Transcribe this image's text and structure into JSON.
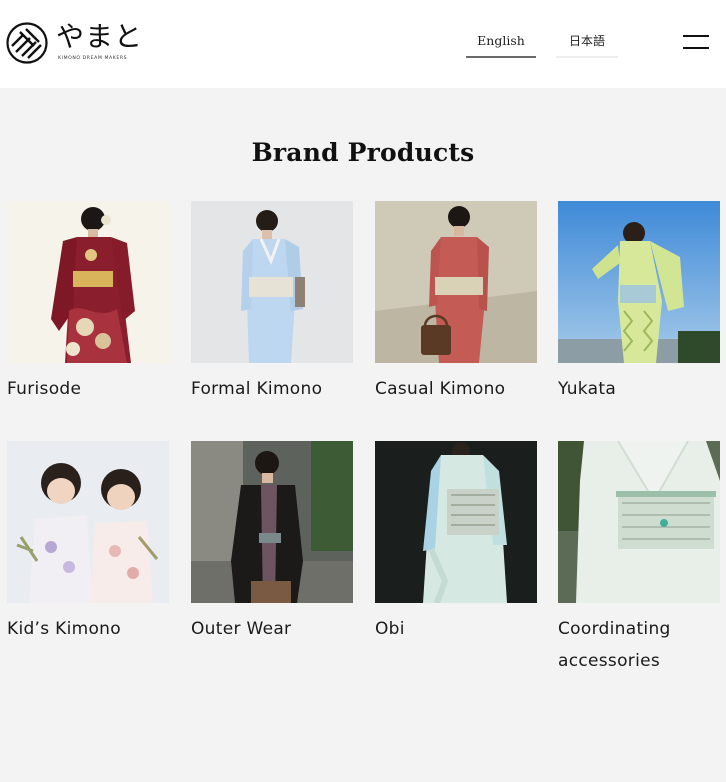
{
  "header": {
    "logo_text": "やまと",
    "logo_subtext": "KIMONO DREAM MAKERS",
    "lang_english": "English",
    "lang_japanese": "日本語",
    "menu_icon": "hamburger-menu-icon"
  },
  "main": {
    "section_title": "Brand Products",
    "products": [
      {
        "label": "Furisode"
      },
      {
        "label": "Formal Kimono"
      },
      {
        "label": "Casual Kimono"
      },
      {
        "label": "Yukata"
      },
      {
        "label": "Kid’s Kimono"
      },
      {
        "label": "Outer Wear"
      },
      {
        "label": "Obi"
      },
      {
        "label": "Coordinating accessories"
      }
    ]
  },
  "colors": {
    "page_background": "#f3f3f3",
    "header_background": "#ffffff",
    "text": "#1a1a1a",
    "active_tab_underline": "#6b6b6b"
  }
}
